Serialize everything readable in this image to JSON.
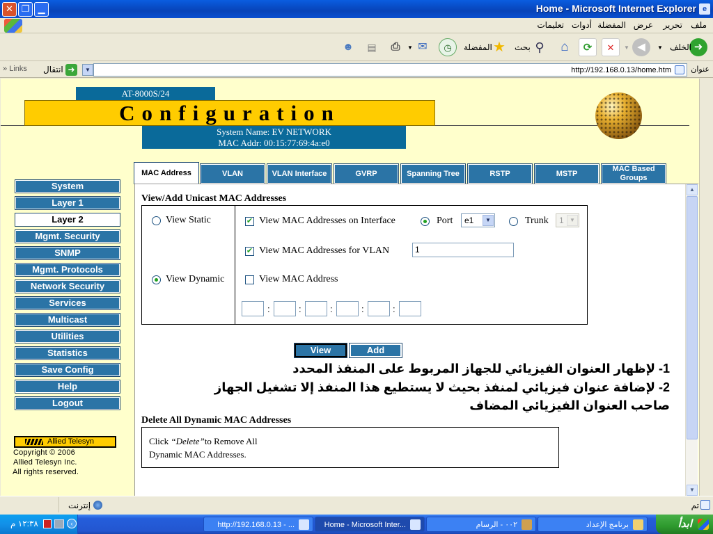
{
  "window": {
    "title": "Home - Microsoft Internet Explorer"
  },
  "menu": [
    "ملف",
    "تحرير",
    "عرض",
    "المفضلة",
    "أدوات",
    "تعليمات"
  ],
  "toolbar": {
    "back_label": "الخلف",
    "search_label": "بحث",
    "favorites_label": "المفضلة"
  },
  "address": {
    "label": "عنوان",
    "url": "http://192.168.0.13/home.htm",
    "go_label": "انتقال",
    "links_label": "Links"
  },
  "header": {
    "model": "AT-8000S/24",
    "title": "Configuration",
    "system_name": "System Name:   EV NETWORK",
    "mac_addr": "MAC Addr:  00:15:77:69:4a:e0"
  },
  "nav": [
    {
      "label": "System"
    },
    {
      "label": "Layer 1"
    },
    {
      "label": "Layer 2"
    },
    {
      "label": "Mgmt. Security"
    },
    {
      "label": "SNMP"
    },
    {
      "label": "Mgmt. Protocols"
    },
    {
      "label": "Network Security"
    },
    {
      "label": "Services"
    },
    {
      "label": "Multicast"
    },
    {
      "label": "Utilities"
    },
    {
      "label": "Statistics"
    },
    {
      "label": "Save Config"
    },
    {
      "label": "Help"
    },
    {
      "label": "Logout"
    }
  ],
  "nav_active": "Layer 2",
  "logo_text": "Allied Telesyn",
  "copyright": [
    "Copyright © 2006",
    "Allied Telesyn Inc.",
    "All rights reserved."
  ],
  "tabs": [
    {
      "label": "MAC Address"
    },
    {
      "label": "VLAN"
    },
    {
      "label": "VLAN Interface"
    },
    {
      "label": "GVRP"
    },
    {
      "label": "Spanning Tree"
    },
    {
      "label": "RSTP"
    },
    {
      "label": "MSTP"
    },
    {
      "label": "MAC Based Groups"
    }
  ],
  "tab_active": "MAC Address",
  "form": {
    "section_title": "View/Add Unicast MAC Addresses",
    "view_static": "View Static",
    "view_dynamic": "View Dynamic",
    "selected_view": "View Dynamic",
    "on_interface_label": "View MAC Addresses on Interface",
    "on_interface_checked": true,
    "port_label": "Port",
    "port_value": "e1",
    "trunk_label": "Trunk",
    "trunk_value": "1",
    "interface_type": "Port",
    "for_vlan_label": "View MAC Addresses for VLAN",
    "for_vlan_checked": true,
    "vlan_value": "1",
    "mac_label": "View MAC Address",
    "mac_checked": false,
    "view_button": "View",
    "add_button": "Add"
  },
  "annotation": {
    "line1": "1- لإظهار العنوان الفيزيائي للجهاز المربوط على المنفذ المحدد",
    "line2": "2- لإضافة عنوان فيزيائي لمنفذ بحيث لا يستطيع هذا المنفذ إلا تشغيل الجهاز",
    "line3": "صاحب العنوان الفيزيائي المضاف"
  },
  "delete": {
    "section_title": "Delete All Dynamic MAC Addresses",
    "text_prefix": "Click ",
    "text_keyword": "“Delete”",
    "text_suffix": "to Remove All",
    "text_line2": "Dynamic MAC Addresses."
  },
  "status": {
    "done": "تم",
    "zone": "إنترنت"
  },
  "taskbar": {
    "start": "ابدأ",
    "tasks": [
      "برنامج الإعداد",
      "٠٠٢ - الرسام",
      "Home - Microsoft Inter...",
      "http://192.168.0.13 - ..."
    ],
    "clock": "١٢:٣٨ م"
  },
  "colors": {
    "nav_blue": "#2b74a6",
    "header_yellow": "#ffcc00",
    "page_bg": "#ffffcc",
    "header_blue": "#0a6a9a"
  }
}
